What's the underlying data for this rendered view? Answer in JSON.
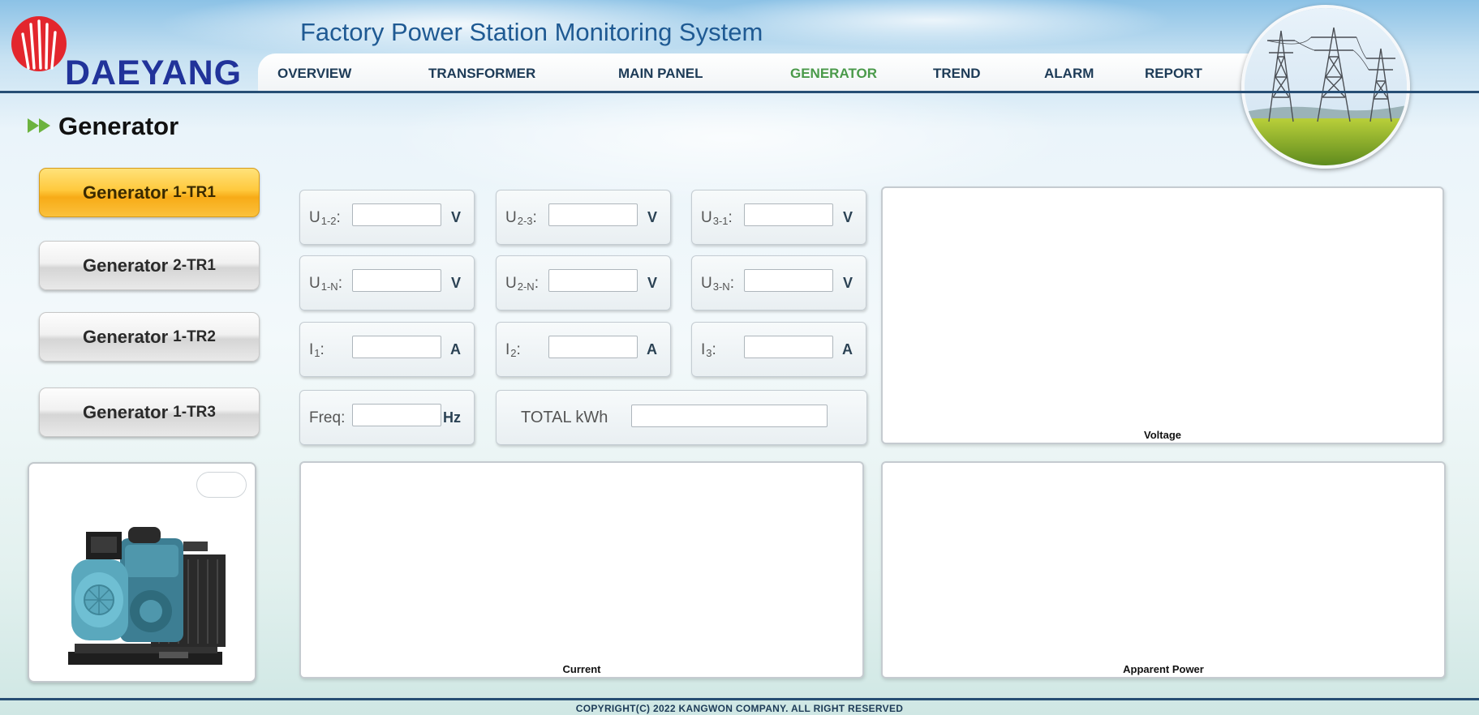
{
  "header": {
    "brand": "DAEYANG",
    "title": "Factory Power Station Monitoring System",
    "nav": [
      {
        "label": "OVERVIEW",
        "active": false
      },
      {
        "label": "TRANSFORMER",
        "active": false
      },
      {
        "label": "MAIN PANEL",
        "active": false
      },
      {
        "label": "GENERATOR",
        "active": true
      },
      {
        "label": "TREND",
        "active": false
      },
      {
        "label": "ALARM",
        "active": false
      },
      {
        "label": "REPORT",
        "active": false
      }
    ]
  },
  "page": {
    "title": "Generator"
  },
  "sidebar": {
    "buttons": [
      {
        "label": "Generator",
        "suffix": "1-TR1",
        "active": true
      },
      {
        "label": "Generator",
        "suffix": "2-TR1",
        "active": false
      },
      {
        "label": "Generator",
        "suffix": "1-TR2",
        "active": false
      },
      {
        "label": "Generator",
        "suffix": "1-TR3",
        "active": false
      }
    ]
  },
  "readings": [
    {
      "label": "U",
      "sub": "1-2",
      "suffix": ":",
      "unit": "V",
      "value": ""
    },
    {
      "label": "U",
      "sub": "2-3",
      "suffix": ":",
      "unit": "V",
      "value": ""
    },
    {
      "label": "U",
      "sub": "3-1",
      "suffix": ":",
      "unit": "V",
      "value": ""
    },
    {
      "label": "U",
      "sub": "1-N",
      "suffix": ":",
      "unit": "V",
      "value": ""
    },
    {
      "label": "U",
      "sub": "2-N",
      "suffix": ":",
      "unit": "V",
      "value": ""
    },
    {
      "label": "U",
      "sub": "3-N",
      "suffix": ":",
      "unit": "V",
      "value": ""
    },
    {
      "label": "I",
      "sub": "1",
      "suffix": ":",
      "unit": "A",
      "value": ""
    },
    {
      "label": "I",
      "sub": "2",
      "suffix": ":",
      "unit": "A",
      "value": ""
    },
    {
      "label": "I",
      "sub": "3",
      "suffix": ":",
      "unit": "A",
      "value": ""
    },
    {
      "label": "Freq",
      "sub": "",
      "suffix": ":",
      "unit": "Hz",
      "value": ""
    }
  ],
  "total_kwh": {
    "label": "TOTAL kWh",
    "value": ""
  },
  "charts": {
    "voltage": "Voltage",
    "current": "Current",
    "apparent_power": "Apparent Power"
  },
  "footer": {
    "copyright": "COPYRIGHT(C) 2022 KANGWON COMPANY. ALL RIGHT RESERVED"
  },
  "colors": {
    "brand": "#21339a",
    "nav_active": "#4a9a4a",
    "button_active": "#f7ab17",
    "accent_line": "#264e74"
  }
}
